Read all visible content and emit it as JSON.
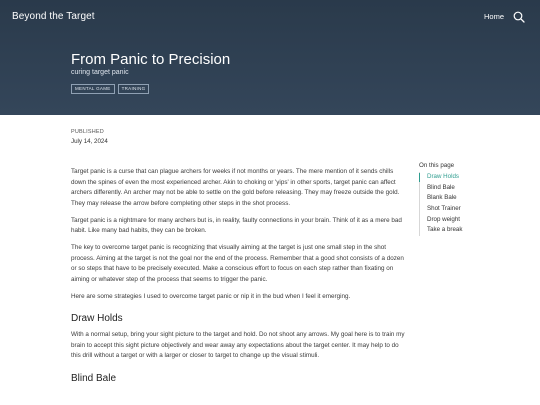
{
  "header": {
    "site_title": "Beyond the Target",
    "nav_home": "Home",
    "search_icon": "search-icon"
  },
  "hero": {
    "title": "From Panic to Precision",
    "subtitle": "curing target panic",
    "tags": [
      "MENTAL GAME",
      "TRAINING"
    ]
  },
  "meta": {
    "published_label": "PUBLISHED",
    "published_date": "July 14, 2024"
  },
  "article": {
    "p1": "Target panic is a curse that can plague archers for weeks if not months or years. The mere mention of it sends chills down the spines of even the most experienced archer. Akin to choking or 'yips' in other sports, target panic can affect archers differently. An archer may not be able to settle on the gold before releasing. They may freeze outside the gold. They may release the arrow before completing other steps in the shot process.",
    "p2": "Target panic is a nightmare for many archers but is, in reality, faulty connections in your brain. Think of it as a mere bad habit. Like many bad habits, they can be broken.",
    "p3": "The key to overcome target panic is recognizing that visually aiming at the target is just one small step in the shot process. Aiming at the target is not the goal nor the end of the process. Remember that a good shot consists of a dozen or so steps that have to be precisely executed. Make a conscious effort to focus on each step rather than fixating on aiming or whatever step of the process that seems to trigger the panic.",
    "p4": "Here are some strategies I used to overcome target panic or nip it in the bud when I feel it emerging.",
    "h_draw_holds": "Draw Holds",
    "p5": "With a normal setup, bring your sight picture to the target and hold. Do not shoot any arrows. My goal here is to train my brain to accept this sight picture objectively and wear away any expectations about the target center. It may help to do this drill without a target or with a larger or closer to target to change up the visual stimuli.",
    "h_blind_bale": "Blind Bale"
  },
  "toc": {
    "title": "On this page",
    "items": [
      "Draw Holds",
      "Blind Bale",
      "Blank Bale",
      "Shot Trainer",
      "Drop weight",
      "Take a break"
    ]
  },
  "colors": {
    "hero_bg": "#2f4154",
    "accent": "#2e9d8f"
  }
}
